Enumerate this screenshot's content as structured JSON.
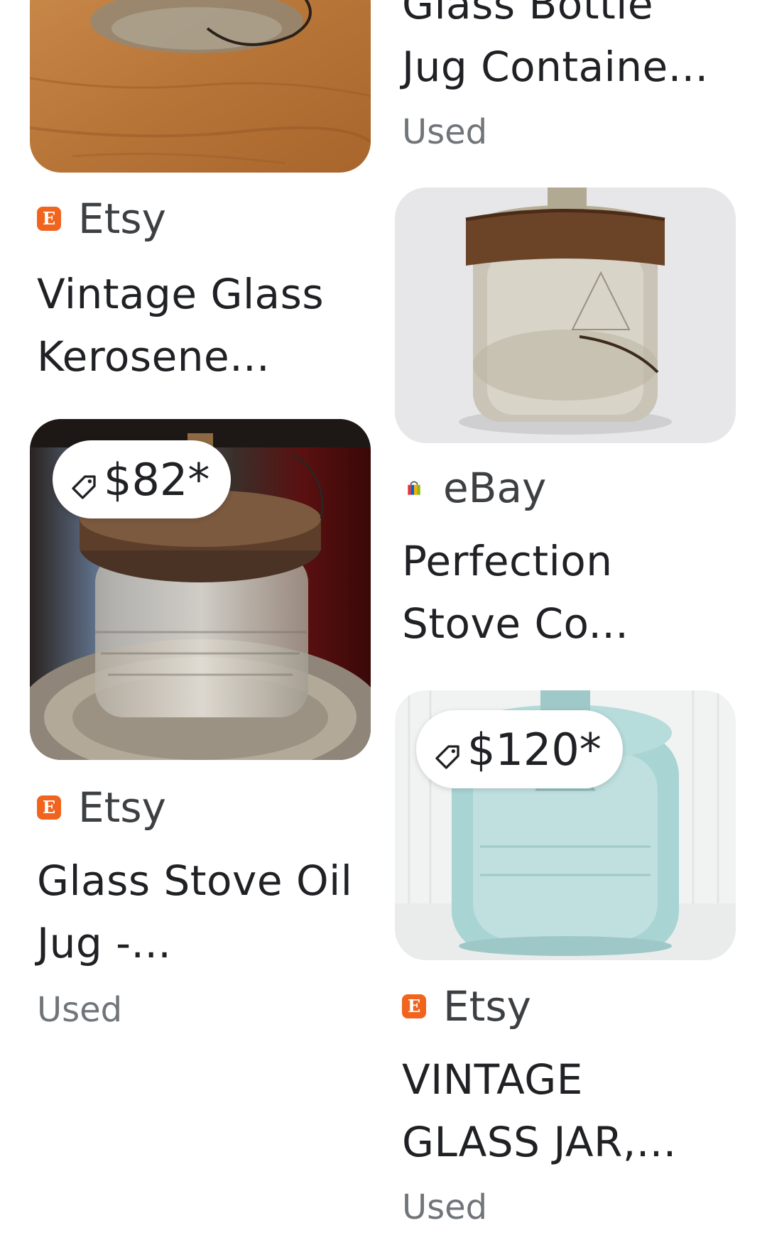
{
  "colors": {
    "etsy_orange": "#f1641e",
    "text_primary": "#202124",
    "text_secondary": "#70757a"
  },
  "left_column": {
    "card1": {
      "source": "Etsy",
      "title_line1": "Vintage Glass",
      "title_line2": "Kerosene..."
    },
    "card2": {
      "price": "$82*",
      "source": "Etsy",
      "title_line1": "Glass Stove Oil",
      "title_line2": "Jug -...",
      "condition": "Used"
    }
  },
  "right_column": {
    "card0": {
      "title_line1": "Glass Bottle",
      "title_line2": "Jug Containe...",
      "condition": "Used"
    },
    "card1": {
      "source": "eBay",
      "title_line1": "Perfection",
      "title_line2": "Stove Co..."
    },
    "card2": {
      "price": "$120*",
      "source": "Etsy",
      "title_line1": "VINTAGE",
      "title_line2": "GLASS JAR,...",
      "condition": "Used"
    }
  },
  "icons": {
    "etsy": "etsy-logo-icon",
    "ebay": "ebay-bag-icon",
    "price_tag": "price-tag-icon"
  }
}
